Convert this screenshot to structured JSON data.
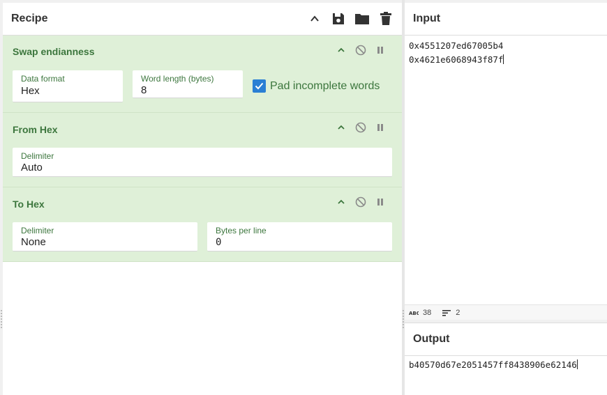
{
  "recipe": {
    "title": "Recipe",
    "operations": [
      {
        "name": "Swap endianness",
        "fields": [
          {
            "label": "Data format",
            "value": "Hex"
          },
          {
            "label": "Word length (bytes)",
            "value": "8"
          }
        ],
        "checkbox": {
          "label": "Pad incomplete words",
          "checked": true
        }
      },
      {
        "name": "From Hex",
        "fields": [
          {
            "label": "Delimiter",
            "value": "Auto"
          }
        ]
      },
      {
        "name": "To Hex",
        "fields": [
          {
            "label": "Delimiter",
            "value": "None"
          },
          {
            "label": "Bytes per line",
            "value": "0"
          }
        ]
      }
    ]
  },
  "input": {
    "title": "Input",
    "lines": [
      "0x4551207ed67005b4",
      "0x4621e6068943f87f"
    ],
    "status": {
      "length": "38",
      "lines": "2"
    }
  },
  "output": {
    "title": "Output",
    "text": "b40570d67e2051457ff8438906e62146"
  },
  "colors": {
    "op_background": "#dff0d8",
    "op_text": "#3c763d",
    "checkbox": "#2a7fd4"
  }
}
